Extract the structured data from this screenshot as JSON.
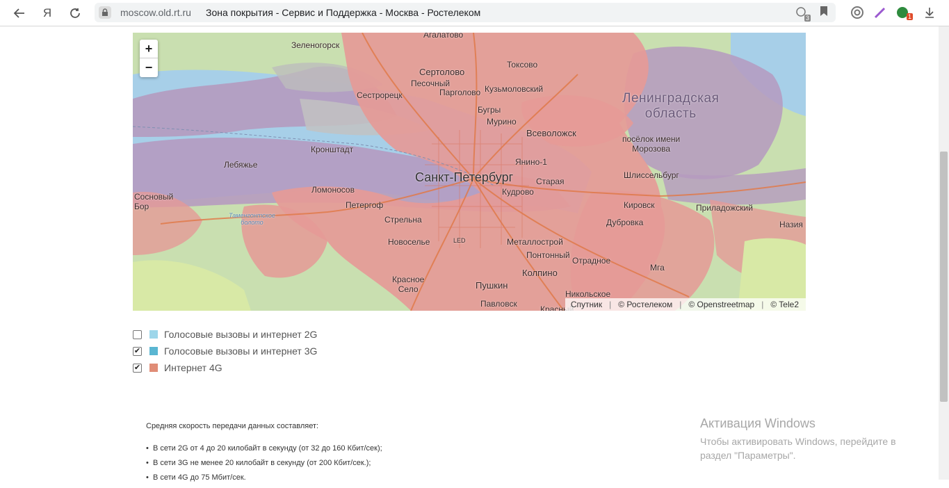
{
  "browser": {
    "url_host": "moscow.old.rt.ru",
    "page_title": "Зона покрытия - Сервис и Поддержка - Москва - Ростелеком",
    "yandex_logo": "Я",
    "tab_badge": "3",
    "ext_badge": "1"
  },
  "map": {
    "zoom_in": "+",
    "zoom_out": "−",
    "attribution": [
      "Спутник",
      "© Ростелеком",
      "© Openstreetmap",
      "© Tele2"
    ],
    "places": {
      "agalatovo": "Агалатово",
      "zelenogorsk": "Зеленогорск",
      "toksovo": "Токсово",
      "sertolovo": "Сертолово",
      "pesochny": "Песочный",
      "sestroretsk": "Сестрорецк",
      "pargolovo": "Парголово",
      "kuzmolovsky": "Кузьмоловский",
      "region": "Ленинградская\nобласть",
      "bugry": "Бугры",
      "murino": "Мурино",
      "vsevolozhsk": "Всеволожск",
      "poselok_morozova": "посёлок имени\nМорозова",
      "kronshtadt": "Кронштадт",
      "yanino": "Янино-1",
      "lebyazhe": "Лебяжье",
      "spb": "Санкт-Петербург",
      "staraya": "Старая",
      "shlisselburg": "Шлиссельбург",
      "lomonosov": "Ломоносов",
      "kudrovo": "Кудрово",
      "sosnovy_bor": "Сосновый\nБор",
      "peterhof": "Петергоф",
      "kirovsk": "Кировск",
      "priladozhsky": "Приладожский",
      "tamengontskoe": "Таменгонтское\nболото",
      "strelna": "Стрельна",
      "dubrovka": "Дубровка",
      "naziya": "Назия",
      "novoselye": "Новоселье",
      "led": "LED",
      "metallostroy": "Металлострой",
      "pontonny": "Понтонный",
      "otradnoe": "Отрадное",
      "mga": "Мга",
      "krasnoe_selo": "Красное\nСело",
      "pushkin": "Пушкин",
      "kolpino": "Колпино",
      "nikolskoe": "Никольское",
      "pavlovsk": "Павловск",
      "krasny_bor": "Красный"
    }
  },
  "legend": [
    {
      "label": "Голосовые вызовы и интернет 2G",
      "checked": false,
      "color": "#9dd6ea"
    },
    {
      "label": "Голосовые вызовы и интернет 3G",
      "checked": true,
      "color": "#5ab6d2"
    },
    {
      "label": "Интернет 4G",
      "checked": true,
      "color": "#e08d77"
    }
  ],
  "speeds": {
    "intro": "Средняя скорость передачи данных составляет:",
    "items": [
      "В сети 2G от 4 до 20 килобайт в секунду (от 32 до 160 Кбит/сек);",
      "В сети 3G не менее 20 килобайт в секунду (от 200 Кбит/сек.);",
      "В сети 4G до 75 Мбит/сек."
    ]
  },
  "watermark": {
    "title": "Активация Windows",
    "text": "Чтобы активировать Windows, перейдите в раздел \"Параметры\"."
  },
  "colors": {
    "coverage_4g": "#e59a97",
    "coverage_3g": "#b59abf",
    "water": "#a7cfe8",
    "land": "#c9dfb0",
    "roads": "#e07a4a"
  }
}
